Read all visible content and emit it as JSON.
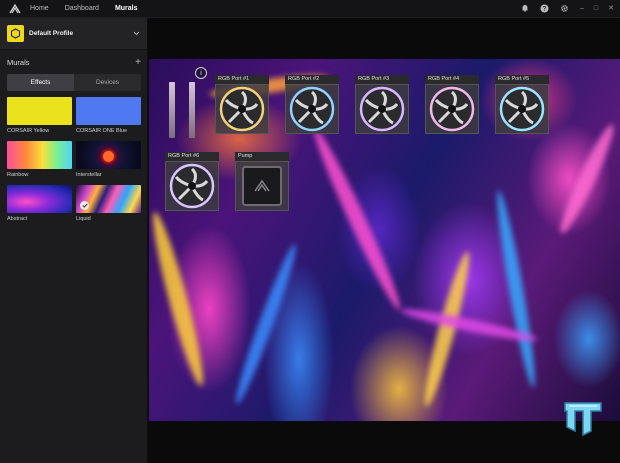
{
  "topbar": {
    "nav": [
      "Home",
      "Dashboard",
      "Murals"
    ],
    "active_nav": "Murals",
    "icons": [
      "bell-icon",
      "help-icon",
      "gear-icon"
    ],
    "window_controls": [
      "–",
      "□",
      "✕"
    ]
  },
  "sidebar": {
    "profile_name": "Default Profile",
    "section_title": "Murals",
    "add_symbol": "+",
    "tabs": [
      "Effects",
      "Devices"
    ],
    "active_tab": "Effects",
    "effects": [
      {
        "label": "CORSAIR Yellow",
        "thumb": "yellow",
        "color": "#eae21c"
      },
      {
        "label": "CORSAIR ONE Blue",
        "thumb": "blue",
        "color": "#4f79f1"
      },
      {
        "label": "Rainbow",
        "thumb": "rainbow"
      },
      {
        "label": "Interstellar",
        "thumb": "inter"
      },
      {
        "label": "Abstract",
        "thumb": "abstract"
      },
      {
        "label": "Liquid",
        "thumb": "liquid",
        "selected": true
      }
    ]
  },
  "preview": {
    "devices": [
      {
        "label": "RGB Port #1",
        "type": "fan",
        "glow": "#f3d27a"
      },
      {
        "label": "RGB Port #2",
        "type": "fan",
        "glow": "#8fd3ff"
      },
      {
        "label": "RGB Port #3",
        "type": "fan",
        "glow": "#d7b7ff"
      },
      {
        "label": "RGB Port #4",
        "type": "fan",
        "glow": "#f0b8e8"
      },
      {
        "label": "RGB Port #5",
        "type": "fan",
        "glow": "#9be6ff"
      },
      {
        "label": "RGB Port #6",
        "type": "fan",
        "glow": "#d9c5ff"
      },
      {
        "label": "Pump",
        "type": "pump"
      }
    ],
    "info_symbol": "i"
  },
  "colors": {
    "accent_yellow": "#ecd91e",
    "sidebar_bg": "#1c1c1e",
    "topbar_bg": "#141416"
  }
}
